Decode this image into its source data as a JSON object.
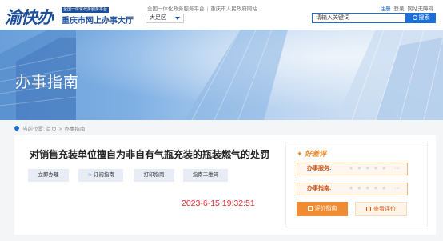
{
  "header": {
    "logo_mark": "渝快办",
    "logo_badge": "全国一体化政务服务平台",
    "site_name": "重庆市网上办事大厅",
    "platform_link": "全国一体化政务服务平台",
    "gov_link": "重庆市人民政府网站",
    "region_value": "大足区",
    "register_label": "注册",
    "login_label": "登录",
    "accessibility_label": "网站无障碍",
    "search_placeholder": "请输入关键词",
    "search_button": "搜索"
  },
  "banner": {
    "title": "办事指南"
  },
  "breadcrumb": {
    "prefix": "当前位置:",
    "home": "首页",
    "separator": ">",
    "current": "办事指南"
  },
  "item": {
    "title": "对销售充装单位擅自为非自有气瓶充装的瓶装燃气的处罚",
    "buttons": {
      "apply": "立即办理",
      "subscribe": "订阅指南",
      "print": "打印指南",
      "qrcode": "指南二维码"
    },
    "timestamp": "2023-6-15 19:32:51"
  },
  "rating": {
    "heading": "好差评",
    "service_label": "办事服务:",
    "guide_label": "办事指南:",
    "stars": "★★★★★",
    "more": "···",
    "rate_button": "评价指南",
    "view_button": "查看评价"
  },
  "colors": {
    "brand_blue": "#1b4e9b",
    "link_blue": "#1b6fd9",
    "accent_orange": "#ee8b33",
    "timestamp_red": "#e12b2b"
  }
}
